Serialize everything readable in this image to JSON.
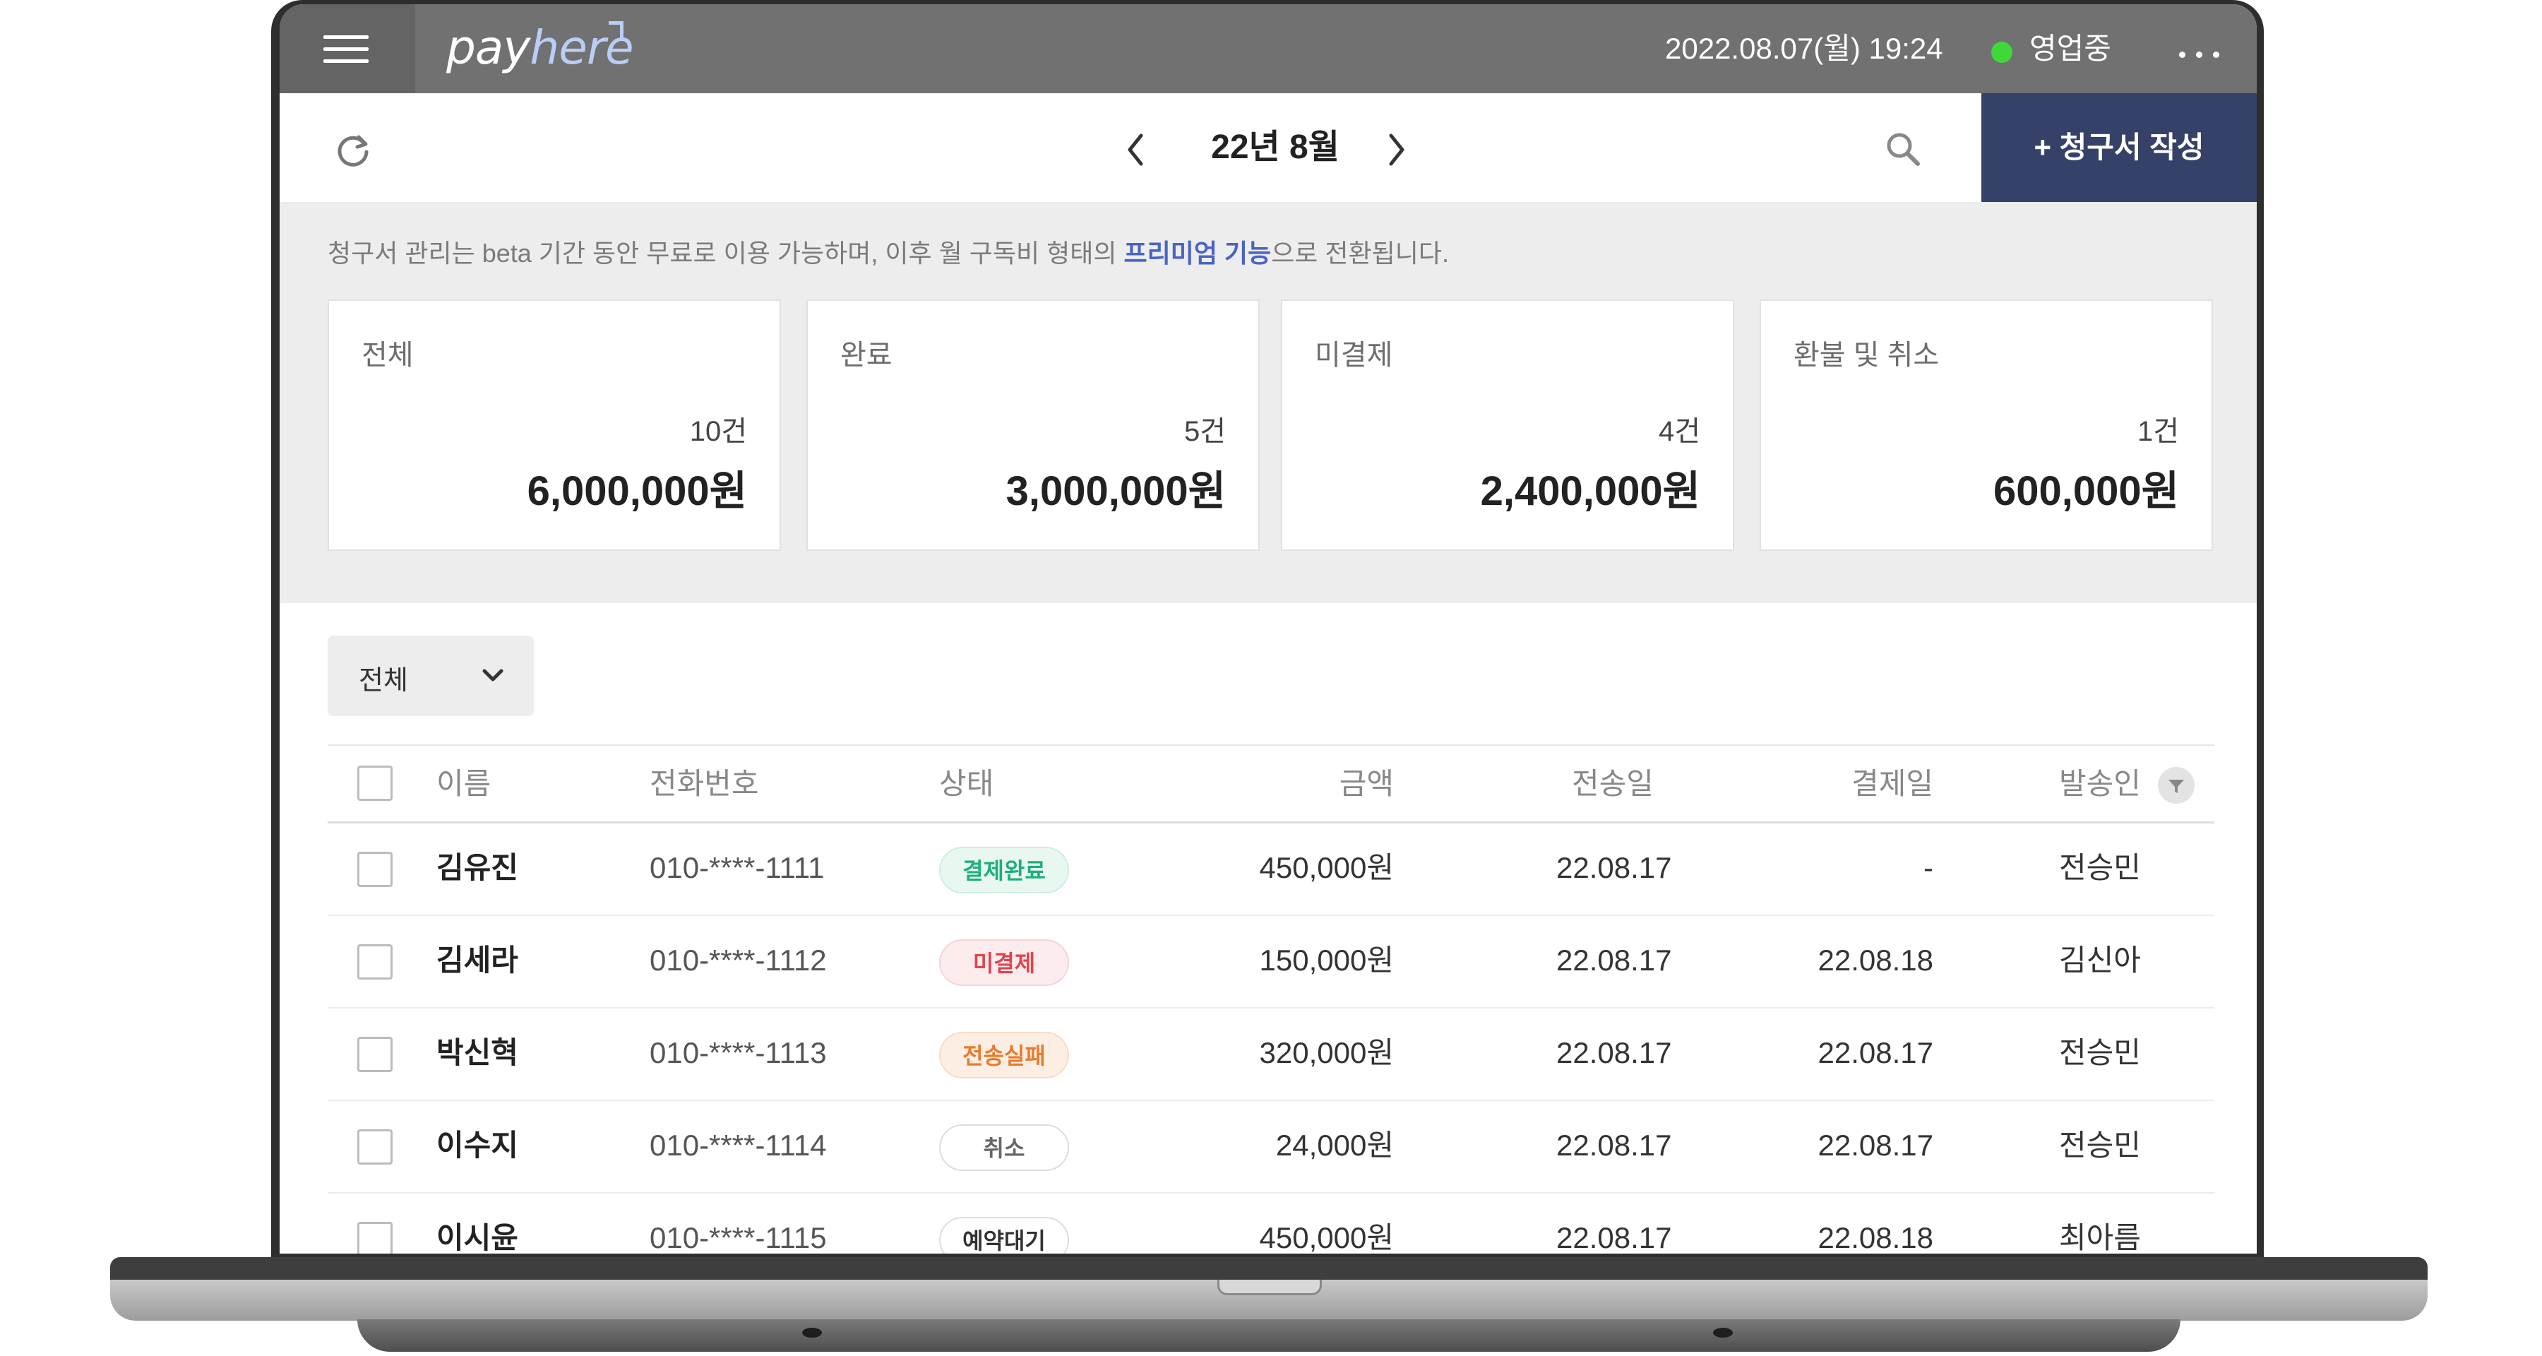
{
  "app": {
    "logo_pay": "pay",
    "logo_here": "here",
    "datetime": "2022.08.07(월) 19:24",
    "status": "영업중",
    "status_color": "#3ed83b"
  },
  "toolbar": {
    "month": "22년 8월",
    "create_button": "+ 청구서 작성",
    "accent_color": "#354168"
  },
  "notice": {
    "before": "청구서 관리는 beta 기간 동안 무료로 이용 가능하며, 이후 월 구독비 형태의 ",
    "link": "프리미엄 기능",
    "after": "으로 전환됩니다."
  },
  "summary": [
    {
      "label": "전체",
      "count": "10건",
      "amount": "6,000,000원"
    },
    {
      "label": "완료",
      "count": "5건",
      "amount": "3,000,000원"
    },
    {
      "label": "미결제",
      "count": "4건",
      "amount": "2,400,000원"
    },
    {
      "label": "환불 및 취소",
      "count": "1건",
      "amount": "600,000원"
    }
  ],
  "filter": {
    "selected": "전체"
  },
  "table": {
    "headers": {
      "name": "이름",
      "phone": "전화번호",
      "status": "상태",
      "amount": "금액",
      "sent_date": "전송일",
      "paid_date": "결제일",
      "sender": "발송인"
    },
    "rows": [
      {
        "name": "김유진",
        "phone": "010-****-1111",
        "status": "결제완료",
        "amount": "450,000원",
        "sent_date": "22.08.17",
        "paid_date": "-",
        "sender": "전승민"
      },
      {
        "name": "김세라",
        "phone": "010-****-1112",
        "status": "미결제",
        "amount": "150,000원",
        "sent_date": "22.08.17",
        "paid_date": "22.08.18",
        "sender": "김신아"
      },
      {
        "name": "박신혁",
        "phone": "010-****-1113",
        "status": "전송실패",
        "amount": "320,000원",
        "sent_date": "22.08.17",
        "paid_date": "22.08.17",
        "sender": "전승민"
      },
      {
        "name": "이수지",
        "phone": "010-****-1114",
        "status": "취소",
        "amount": "24,000원",
        "sent_date": "22.08.17",
        "paid_date": "22.08.17",
        "sender": "전승민"
      },
      {
        "name": "이시윤",
        "phone": "010-****-1115",
        "status": "예약대기",
        "amount": "450,000원",
        "sent_date": "22.08.17",
        "paid_date": "22.08.18",
        "sender": "최아름"
      }
    ]
  },
  "status_styles": {
    "결제완료": {
      "text": "#1fae7c",
      "bg": "#e8f8f1",
      "border": "#cfeee2"
    },
    "미결제": {
      "text": "#e1434d",
      "bg": "#fdecee",
      "border": "#f7d3d6"
    },
    "전송실패": {
      "text": "#ea7a2e",
      "bg": "#fdeee3",
      "border": "#f8dcc6"
    },
    "취소": {
      "text": "#666666",
      "bg": "#ffffff",
      "border": "#dddddd"
    },
    "예약대기": {
      "text": "#333333",
      "bg": "#ffffff",
      "border": "#dddddd"
    }
  },
  "icons": {
    "menu": "hamburger-icon",
    "more": "more-horizontal-icon",
    "refresh": "refresh-icon",
    "prev": "chevron-left-icon",
    "next": "chevron-right-icon",
    "search": "search-icon",
    "dropdown": "chevron-down-icon",
    "filter": "filter-icon"
  }
}
